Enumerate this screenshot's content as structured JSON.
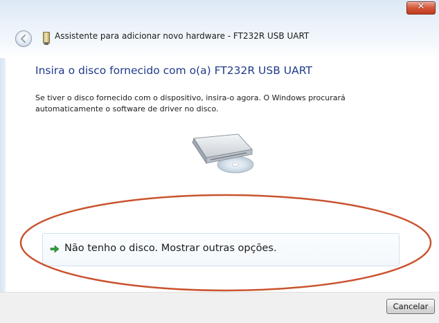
{
  "window": {
    "title": "Assistente para adicionar novo hardware - FT232R USB UART",
    "close_glyph": "✕"
  },
  "content": {
    "heading": "Insira o disco fornecido com o(a) FT232R USB UART",
    "description_line1": "Se tiver o disco fornecido com o dispositivo, insira-o agora. O Windows procurará",
    "description_line2": "automaticamente o software de driver no disco.",
    "image_icon": "cd-drive-icon"
  },
  "options": [
    {
      "label": "Não tenho o disco. Mostrar outras opções.",
      "icon": "green-arrow-icon"
    }
  ],
  "footer": {
    "cancel_label": "Cancelar"
  },
  "colors": {
    "heading": "#1f3a8a",
    "highlight_ellipse": "#c9532e",
    "arrow": "#2f9a3a"
  }
}
